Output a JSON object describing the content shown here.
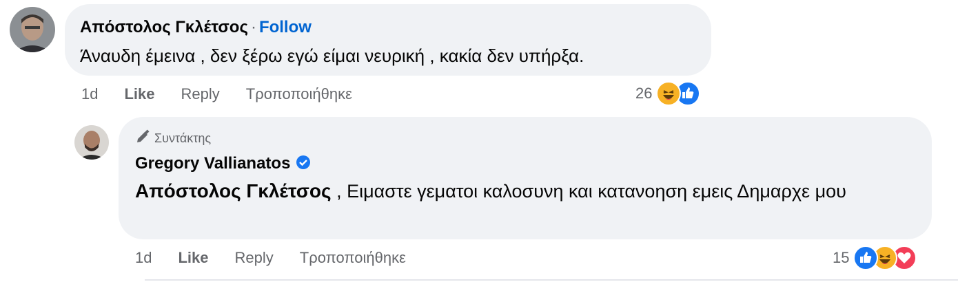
{
  "comment1": {
    "author": "Απόστολος Γκλέτσος",
    "separator": "·",
    "follow_label": "Follow",
    "text": "Άναυδη έμεινα , δεν ξέρω εγώ είμαι νευρική , κακία δεν υπήρξα.",
    "time": "1d",
    "like_label": "Like",
    "reply_label": "Reply",
    "edited_label": "Τροποποιήθηκε",
    "reaction_count": "26",
    "reactions": [
      "haha-icon",
      "like-icon"
    ]
  },
  "reply1": {
    "badge_label": "Συντάκτης",
    "author": "Gregory Vallianatos",
    "verified": true,
    "mention": "Απόστολος Γκλέτσος",
    "text": " , Ειμαστε γεματοι καλοσυνη και κατανοηση εμεις Δημαρχε μου",
    "time": "1d",
    "like_label": "Like",
    "reply_label": "Reply",
    "edited_label": "Τροποποιήθηκε",
    "reaction_count": "15",
    "reactions": [
      "like-icon",
      "haha-icon",
      "love-icon"
    ]
  },
  "colors": {
    "bubble": "#f0f2f5",
    "link": "#0064d1",
    "secondary_text": "#65676b",
    "like_blue": "#1877f2",
    "love_red": "#f33e58",
    "haha_yellow": "#f7b125"
  }
}
